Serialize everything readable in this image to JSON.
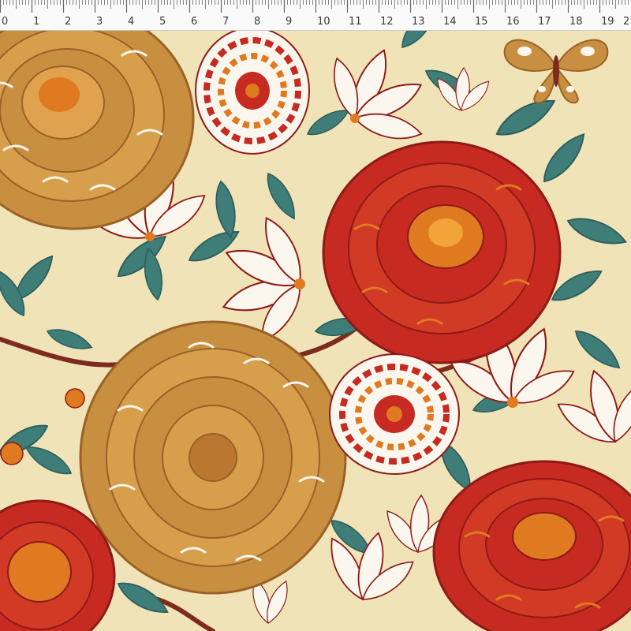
{
  "ruler": {
    "labels": [
      "0",
      "1",
      "2",
      "3",
      "4",
      "5",
      "6",
      "7",
      "8",
      "9",
      "10",
      "11",
      "12",
      "13",
      "14",
      "15",
      "16",
      "17",
      "18",
      "19",
      "2"
    ]
  },
  "colors": {
    "background": "#f1e3b8",
    "gold": "#c98f40",
    "gold_dark": "#9a6226",
    "red": "#c62a21",
    "red_dark": "#8e1a17",
    "orange": "#e07a20",
    "teal": "#3f7d78",
    "teal_dark": "#2d5f5c",
    "white": "#fbf7ee",
    "branch": "#7d2a1f"
  },
  "motifs": {
    "gold_peony_top_left": "gold-peony",
    "gold_peony_center": "gold-peony",
    "red_peony_right": "red-peony",
    "red_peony_bottom_right": "red-peony",
    "red_peony_bottom_left": "red-peony",
    "carnation_top": "carnation",
    "carnation_center": "carnation",
    "butterfly": "butterfly"
  }
}
